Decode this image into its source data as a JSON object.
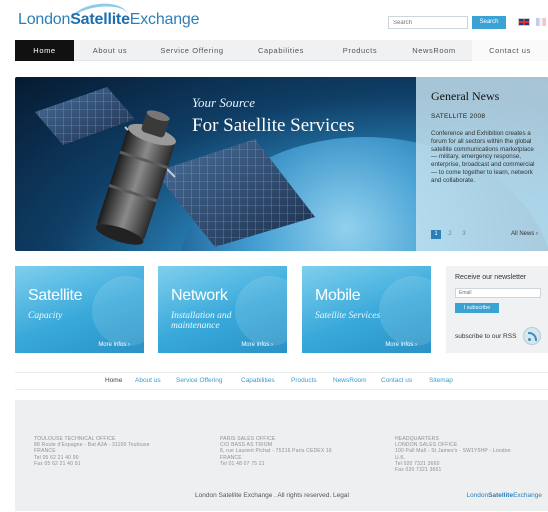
{
  "header": {
    "logo_prefix": "London",
    "logo_bold": "Satellite",
    "logo_suffix": "Exchange",
    "search_placeholder": "Search",
    "search_button": "Search"
  },
  "nav": {
    "items": [
      {
        "label": "Home",
        "active": true
      },
      {
        "label": "About us"
      },
      {
        "label": "Service Offering"
      },
      {
        "label": "Capabilities"
      },
      {
        "label": "Products"
      },
      {
        "label": "NewsRoom"
      },
      {
        "label": "Contact us"
      }
    ]
  },
  "hero": {
    "tagline_1": "Your Source",
    "tagline_2": "For Satellite Services"
  },
  "news": {
    "title": "General News",
    "subtitle": "SATELLITE 2008",
    "body": "Conference and Exhibition creates a forum for all sectors within the global satellite communications marketplace — military, emergency response, enterprise, broadcast and commercial — to come together to learn, network and collaborate.",
    "pages": [
      "1",
      "2",
      "3"
    ],
    "all_news": "All News ›"
  },
  "tiles": [
    {
      "title": "Satellite",
      "subtitle": "Capacity",
      "more": "More infos ›"
    },
    {
      "title": "Network",
      "subtitle": "Installation and maintenance",
      "more": "More infos ›"
    },
    {
      "title": "Mobile",
      "subtitle": "Satellite Services",
      "more": "More infos ›"
    }
  ],
  "newsletter": {
    "title": "Receive our newsletter",
    "email_placeholder": "Email",
    "subscribe_button": "I subscribe",
    "rss_label": "subscribe to our RSS"
  },
  "footer_nav": {
    "items": [
      "Home",
      "About us",
      "Service Offering",
      "Capabilities",
      "Products",
      "NewsRoom",
      "Contact us",
      "Sitemap"
    ]
  },
  "footer": {
    "offices": [
      {
        "name": "Toulouse technical office",
        "lines": [
          "88 Route d'Espagne - Bat A3A - 31100 Toulouse",
          "FRANCE",
          "Tel 05 62 21 40 90",
          "Fax 05 62 21 40 91"
        ]
      },
      {
        "name": "Paris sales office",
        "lines": [
          "C/O BASS AS TRIOM",
          "8, rue Laurent Pichat - 75216 Paris CEDEX 16",
          "FRANCE",
          "Tel 01 48 07 75 21"
        ]
      },
      {
        "name": "Headquarters",
        "lines": [
          "London sales office",
          "100 Pall Mall - St James's - SW1Y5HP - London",
          "U.K.",
          "Tel 020 7321 3660",
          "Fax 020 7321 3661"
        ]
      }
    ],
    "copyright": "London Satellite Exchange . All rights reserved. Legal",
    "logo_prefix": "London",
    "logo_bold": "Satellite",
    "logo_suffix": "Exchange"
  }
}
